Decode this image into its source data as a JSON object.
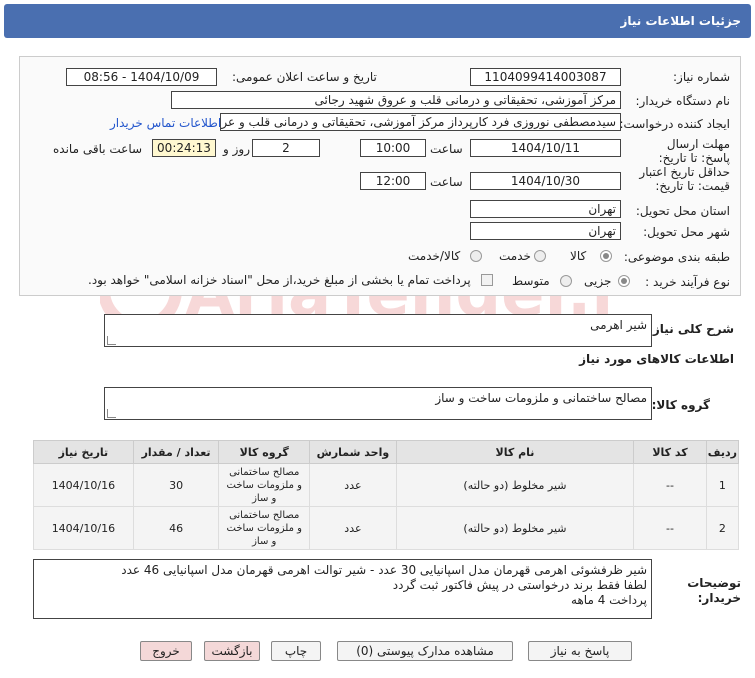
{
  "title": "جزئیات اطلاعات نیاز",
  "fields": {
    "need_number_label": "شماره نیاز:",
    "need_number": "1104099414003087",
    "announce_label": "تاریخ و ساعت اعلان عمومی:",
    "announce_value": "1404/10/09 - 08:56",
    "buyer_label": "نام دستگاه خریدار:",
    "buyer_value": "مرکز آموزشی، تحقیقاتی و درمانی قلب و عروق شهید رجائی",
    "creator_label": "ایجاد کننده درخواست:",
    "creator_value": "سیدمصطفی نوروزی فرد کارپرداز مرکز آموزشی، تحقیقاتی و درمانی قلب و عروق",
    "contact_link": "اطلاعات تماس خریدار",
    "deadline_label": "مهلت ارسال پاسخ: تا تاریخ:",
    "deadline_date": "1404/10/11",
    "time_label": "ساعت",
    "deadline_time": "10:00",
    "days_value": "2",
    "days_label": "روز و",
    "remaining_time": "00:24:13",
    "remaining_label": "ساعت باقی مانده",
    "validity_label": "حداقل تاریخ اعتبار قیمت: تا تاریخ:",
    "validity_date": "1404/10/30",
    "validity_time": "12:00",
    "province_label": "استان محل تحویل:",
    "province_value": "تهران",
    "city_label": "شهر محل تحویل:",
    "city_value": "تهران",
    "category_label": "طبقه بندی موضوعی:",
    "category_options": [
      "کالا",
      "خدمت",
      "کالا/خدمت"
    ],
    "process_label": "نوع فرآیند خرید :",
    "process_options": [
      "جزیی",
      "متوسط"
    ],
    "payment_note": "پرداخت تمام یا بخشی از مبلغ خرید،از محل \"اسناد خزانه اسلامی\" خواهد بود."
  },
  "summary": {
    "label": "شرح کلی نیاز:",
    "value": "شیر اهرمی"
  },
  "goods_info_title": "اطلاعات کالاهای مورد نیاز",
  "goods_group": {
    "label": "گروه کالا:",
    "value": "مصالح ساختمانی و ملزومات ساخت و ساز"
  },
  "table": {
    "headers": [
      "ردیف",
      "کد کالا",
      "نام کالا",
      "واحد شمارش",
      "گروه کالا",
      "تعداد / مقدار",
      "تاریخ نیاز"
    ],
    "rows": [
      [
        "1",
        "--",
        "شیر مخلوط (دو حالته)",
        "عدد",
        "مصالح ساختمانی و ملزومات ساخت و ساز",
        "30",
        "1404/10/16"
      ],
      [
        "2",
        "--",
        "شیر مخلوط (دو حالته)",
        "عدد",
        "مصالح ساختمانی و ملزومات ساخت و ساز",
        "46",
        "1404/10/16"
      ]
    ]
  },
  "buyer_notes": {
    "label": "توضیحات خریدار:",
    "lines": [
      "شیر ظرفشوئی اهرمی قهرمان مدل اسپانیایی 30 عدد - شیر توالت اهرمی قهرمان مدل اسپانیایی 46 عدد",
      "لطفا فقط برند درخواستی در پیش فاکتور ثبت گردد",
      "پرداخت 4 ماهه"
    ]
  },
  "buttons": {
    "respond": "پاسخ به نیاز",
    "attachments": "مشاهده مدارک پیوستی (0)",
    "print": "چاپ",
    "back": "بازگشت",
    "exit": "خروج"
  },
  "watermark_text": "AriaTender.neT"
}
